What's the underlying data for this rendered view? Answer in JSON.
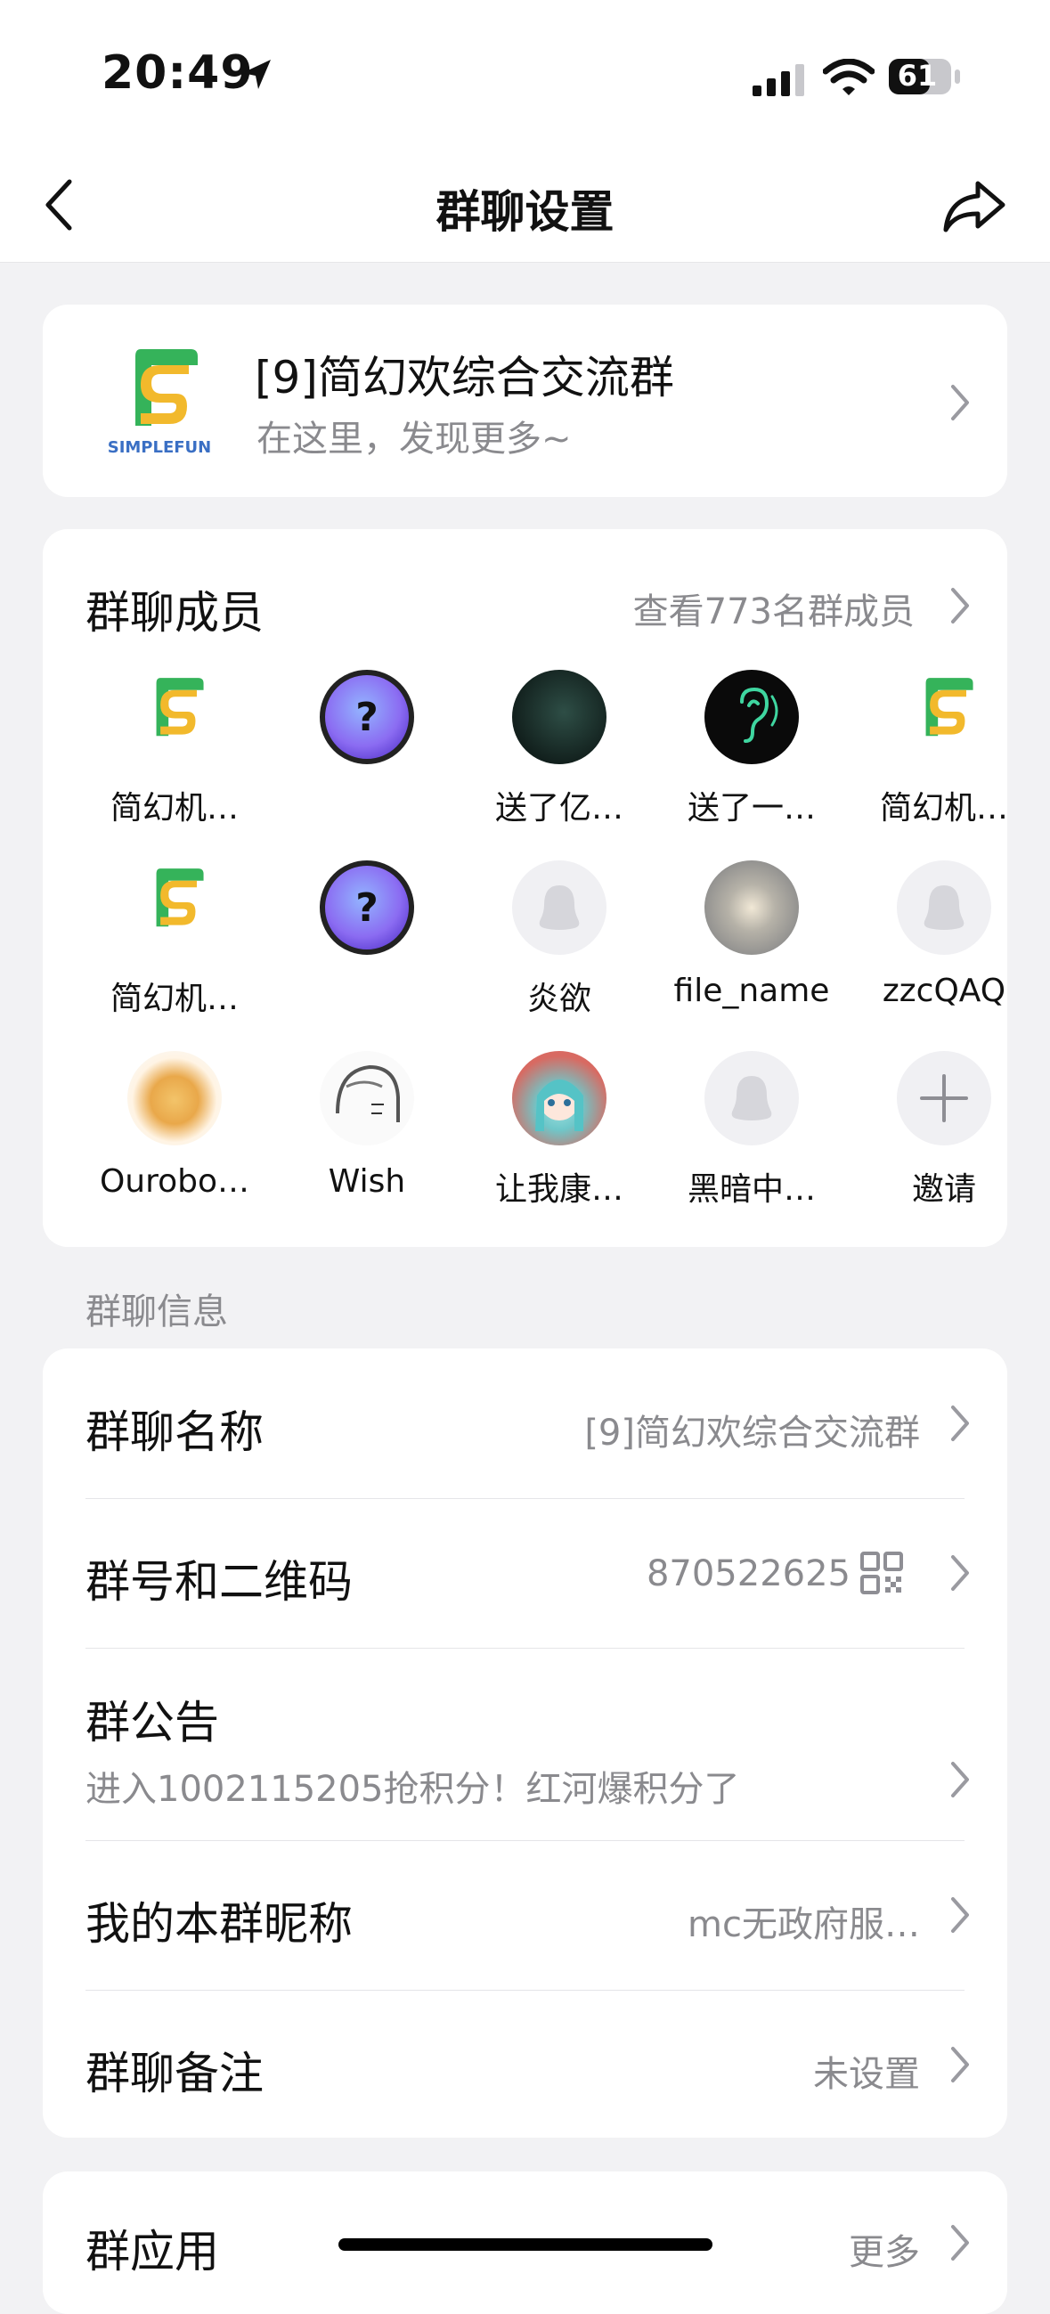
{
  "status": {
    "time": "20:49",
    "battery": "61"
  },
  "nav": {
    "title": "群聊设置"
  },
  "group": {
    "name": "[9]简幻欢综合交流群",
    "slogan": "在这里，发现更多~",
    "logo_text": "SIMPLEFUN"
  },
  "members": {
    "title": "群聊成员",
    "view_all": "查看773名群成员",
    "list": [
      {
        "name": "简幻机…",
        "avatar": "simplefun-logo"
      },
      {
        "name": "",
        "avatar": "question-badge"
      },
      {
        "name": "送了亿…",
        "avatar": "dark-forest"
      },
      {
        "name": "送了一…",
        "avatar": "ear-icon"
      },
      {
        "name": "简幻机…",
        "avatar": "simplefun-logo"
      },
      {
        "name": "简幻机…",
        "avatar": "simplefun-logo"
      },
      {
        "name": "",
        "avatar": "question-badge"
      },
      {
        "name": "炎欲",
        "avatar": "penguin-default"
      },
      {
        "name": "file_name",
        "avatar": "blurred-light"
      },
      {
        "name": "zzcQAQ",
        "avatar": "penguin-default"
      },
      {
        "name": "Ourobo…",
        "avatar": "pie"
      },
      {
        "name": "Wish",
        "avatar": "sketch"
      },
      {
        "name": "让我康…",
        "avatar": "anime-girl"
      },
      {
        "name": "黑暗中…",
        "avatar": "penguin-default"
      },
      {
        "name": "邀请",
        "avatar": "plus-icon"
      }
    ]
  },
  "info": {
    "section_label": "群聊信息",
    "group_name_label": "群聊名称",
    "group_name_value": "[9]简幻欢综合交流群",
    "group_id_label": "群号和二维码",
    "group_id_value": "870522625",
    "announcement_label": "群公告",
    "announcement_value": "进入1002115205抢积分！红河爆积分了",
    "nickname_label": "我的本群昵称",
    "nickname_value": "mc无政府服…",
    "remark_label": "群聊备注",
    "remark_value": "未设置"
  },
  "apps": {
    "label": "群应用",
    "more": "更多"
  },
  "colors": {
    "accent_green": "#35b35a",
    "accent_yellow": "#f2b92c",
    "logo_blue": "#3a6fc4"
  }
}
